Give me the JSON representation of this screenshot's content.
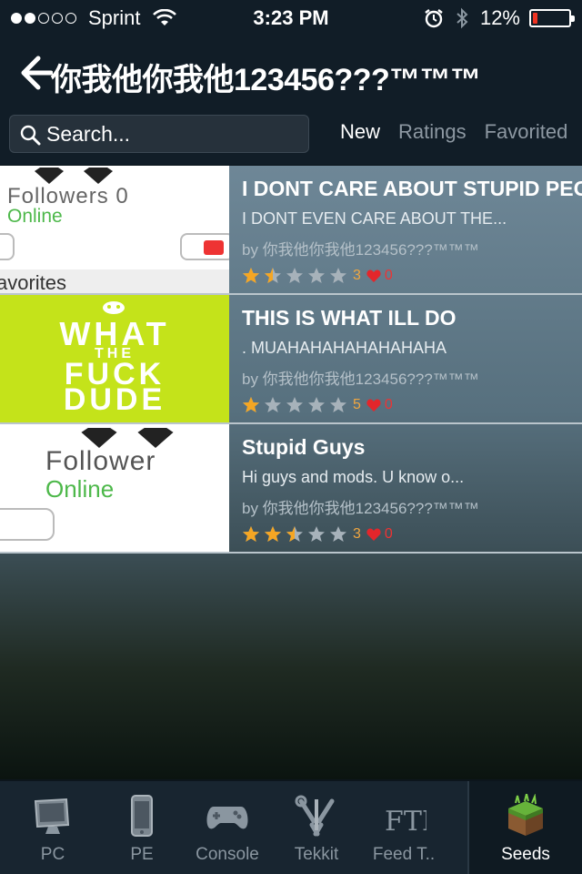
{
  "status_bar": {
    "carrier": "Sprint",
    "time": "3:23 PM",
    "battery": "12%",
    "battery_level": 0.12,
    "signal_bars_filled": 2,
    "signal_bars_total": 5
  },
  "nav": {
    "title": "你我他你我他123456???™™™"
  },
  "search": {
    "placeholder": "Search..."
  },
  "sort_tabs": [
    {
      "label": "New",
      "active": true
    },
    {
      "label": "Ratings",
      "active": false
    },
    {
      "label": "Favorited",
      "active": false
    }
  ],
  "rows": [
    {
      "title": "I DONT CARE ABOUT STUPID PEOPLE",
      "description": "I DONT EVEN CARE ABOUT THE...",
      "author": "by 你我他你我他123456???™™™",
      "rating": 1.5,
      "rating_count": "3",
      "favorites": "0",
      "thumb": {
        "line1": "Followers 0",
        "line2": "Online",
        "line3": "avorites"
      }
    },
    {
      "title": "THIS IS WHAT ILL DO",
      "description": ". MUAHAHAHAHAHAHAHA",
      "author": "by 你我他你我他123456???™™™",
      "rating": 1,
      "rating_count": "5",
      "favorites": "0",
      "thumb": {
        "line1": "WHAT",
        "line2": "THE",
        "line3": "FUCK",
        "line4": "DUDE"
      }
    },
    {
      "title": "Stupid Guys",
      "description": "Hi guys and mods. U know o...",
      "author": "by 你我他你我他123456???™™™",
      "rating": 2.5,
      "rating_count": "3",
      "favorites": "0",
      "thumb": {
        "line1": "Follower",
        "line2": "Online"
      }
    }
  ],
  "tabs": [
    {
      "label": "PC",
      "icon": "monitor-icon",
      "selected": false
    },
    {
      "label": "PE",
      "icon": "phone-icon",
      "selected": false
    },
    {
      "label": "Console",
      "icon": "gamepad-icon",
      "selected": false
    },
    {
      "label": "Tekkit",
      "icon": "tools-icon",
      "selected": false
    },
    {
      "label": "Feed T..",
      "icon": "ftb-logo-icon",
      "selected": false
    },
    {
      "label": "Seeds",
      "icon": "grass-block-icon",
      "selected": true
    }
  ],
  "colors": {
    "star_on": "#f5a623",
    "star_off": "#a7b2ba",
    "heart": "#e3262b",
    "lime_thumb": "#c4e31a",
    "online_green": "#4db84a"
  }
}
